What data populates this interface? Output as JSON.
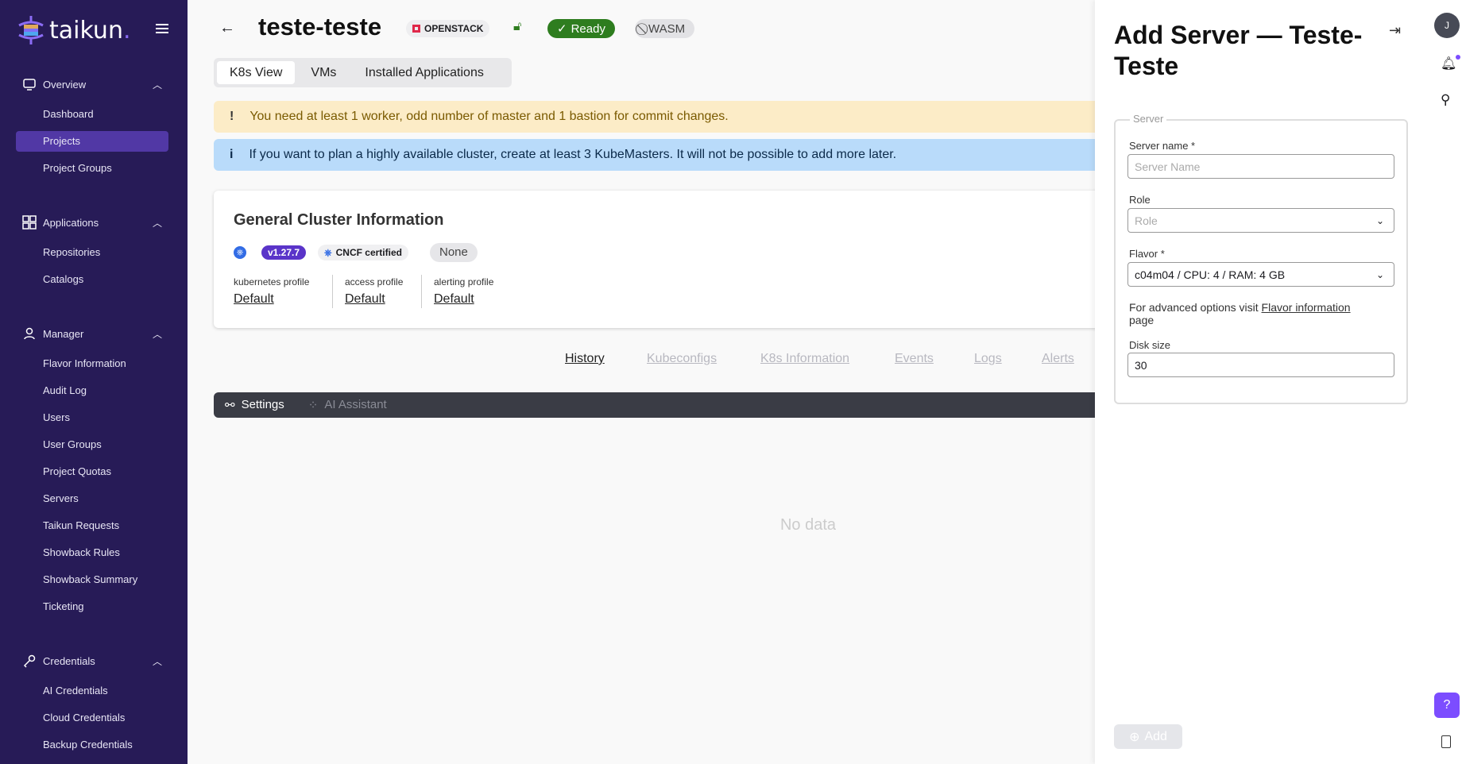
{
  "brand": {
    "name": "taikun",
    "dot": "."
  },
  "sidebar": {
    "sections": [
      {
        "label": "Overview",
        "icon": "monitor-icon",
        "items": [
          "Dashboard",
          "Projects",
          "Project Groups"
        ]
      },
      {
        "label": "Applications",
        "icon": "grid-icon",
        "items": [
          "Repositories",
          "Catalogs"
        ]
      },
      {
        "label": "Manager",
        "icon": "user-icon",
        "items": [
          "Flavor Information",
          "Audit Log",
          "Users",
          "User Groups",
          "Project Quotas",
          "Servers",
          "Taikun Requests",
          "Showback Rules",
          "Showback Summary",
          "Ticketing"
        ]
      },
      {
        "label": "Credentials",
        "icon": "key-icon",
        "items": [
          "AI Credentials",
          "Cloud Credentials",
          "Backup Credentials"
        ]
      }
    ],
    "active": "Projects"
  },
  "header": {
    "title": "teste-teste",
    "cloud": "OPENSTACK",
    "status": "Ready",
    "wasm": "WASM"
  },
  "view_tabs": [
    "K8s View",
    "VMs",
    "Installed Applications"
  ],
  "banners": {
    "warning": "You need at least 1 worker, odd number of master and 1 bastion for commit changes.",
    "info": "If you want to plan a highly available cluster, create at least 3 KubeMasters. It will not be possible to add more later."
  },
  "cluster": {
    "title": "General Cluster Information",
    "version": "v1.27.7",
    "cncf": "CNCF certified",
    "extra": "None",
    "profiles": [
      {
        "label": "kubernetes profile",
        "value": "Default"
      },
      {
        "label": "access profile",
        "value": "Default"
      },
      {
        "label": "alerting profile",
        "value": "Default"
      }
    ]
  },
  "lower_tabs": [
    "History",
    "Kubeconfigs",
    "K8s Information",
    "Events",
    "Logs",
    "Alerts"
  ],
  "toolbar": {
    "settings": "Settings",
    "ai": "AI Assistant"
  },
  "empty": "No data",
  "panel": {
    "title": "Add Server — Teste-Teste",
    "legend": "Server",
    "server_name_label": "Server name *",
    "server_name_placeholder": "Server Name",
    "role_label": "Role",
    "role_placeholder": "Role",
    "flavor_label": "Flavor *",
    "flavor_value": "c04m04 / CPU: 4 / RAM: 4 GB",
    "hint_prefix": "For advanced options visit ",
    "hint_link": "Flavor information",
    "hint_suffix": "page",
    "disk_label": "Disk size",
    "disk_value": "30",
    "add": "Add"
  },
  "user": {
    "initial": "J"
  },
  "colors": {
    "sidebar": "#271b57",
    "accent": "#7c4dff",
    "ready": "#2e7d1f",
    "warning_bg": "#fcecc7",
    "info_bg": "#b9dbfa"
  }
}
